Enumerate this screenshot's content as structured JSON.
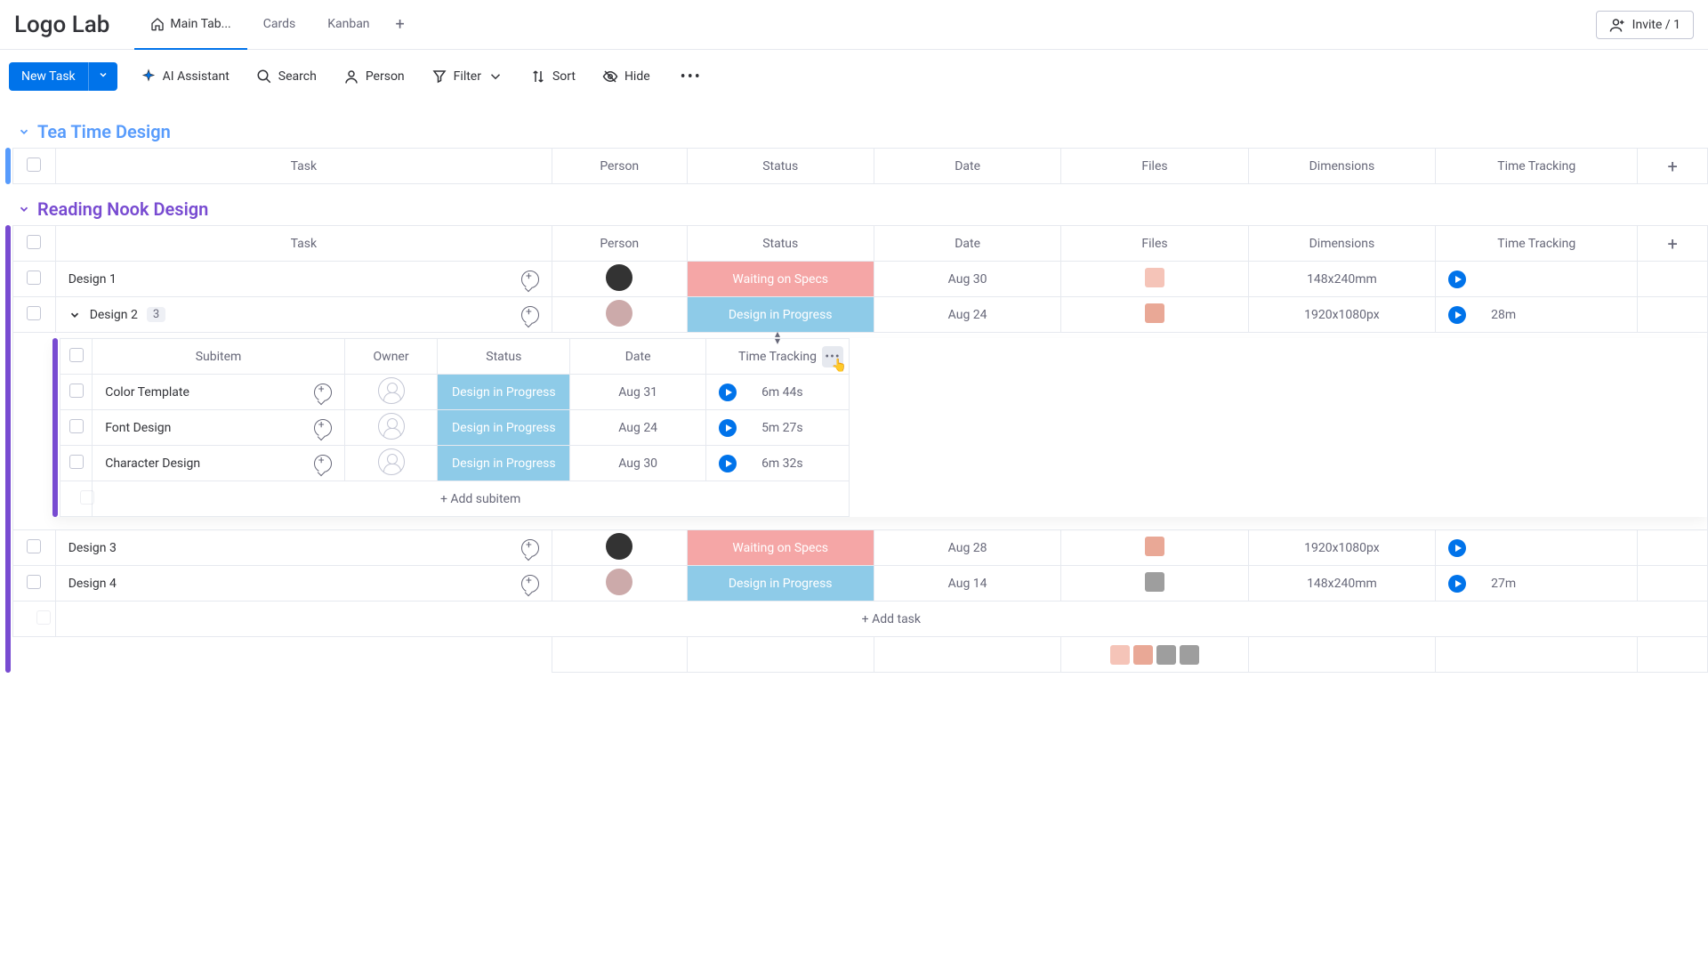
{
  "brand": "Logo Lab",
  "top_tabs": {
    "main": "Main Tab...",
    "cards": "Cards",
    "kanban": "Kanban"
  },
  "invite": "Invite / 1",
  "toolbar": {
    "new_task": "New Task",
    "ai": "AI Assistant",
    "search": "Search",
    "person": "Person",
    "filter": "Filter",
    "sort": "Sort",
    "hide": "Hide"
  },
  "columns": {
    "task": "Task",
    "person": "Person",
    "status": "Status",
    "date": "Date",
    "files": "Files",
    "dimensions": "Dimensions",
    "time": "Time Tracking",
    "subitem": "Subitem",
    "owner": "Owner"
  },
  "groups": {
    "tea": {
      "name": "Tea Time Design"
    },
    "reading": {
      "name": "Reading Nook Design",
      "rows": [
        {
          "name": "Design 1",
          "status": "Waiting on Specs",
          "status_class": "sc-wait",
          "date": "Aug 30",
          "dimensions": "148x240mm",
          "time": ""
        },
        {
          "name": "Design 2",
          "badge": "3",
          "status": "Design in Progress",
          "status_class": "sc-prog",
          "date": "Aug 24",
          "dimensions": "1920x1080px",
          "time": "28m"
        },
        {
          "name": "Design 3",
          "status": "Waiting on Specs",
          "status_class": "sc-wait",
          "date": "Aug 28",
          "dimensions": "1920x1080px",
          "time": ""
        },
        {
          "name": "Design 4",
          "status": "Design in Progress",
          "status_class": "sc-prog",
          "date": "Aug 14",
          "dimensions": "148x240mm",
          "time": "27m"
        }
      ],
      "subitems": [
        {
          "name": "Color Template",
          "status": "Design in Progress",
          "date": "Aug 31",
          "time": "6m 44s"
        },
        {
          "name": "Font Design",
          "status": "Design in Progress",
          "date": "Aug 24",
          "time": "5m 27s"
        },
        {
          "name": "Character Design",
          "status": "Design in Progress",
          "date": "Aug 30",
          "time": "6m 32s"
        }
      ],
      "add_subitem": "+ Add subitem",
      "add_task": "+ Add task"
    }
  }
}
